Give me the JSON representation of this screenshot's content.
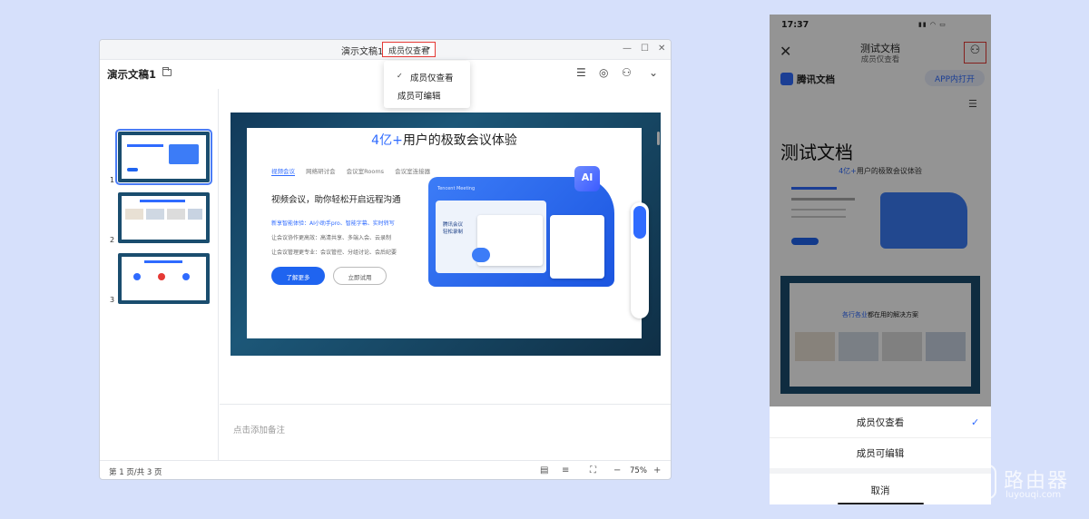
{
  "desktop": {
    "window_title": "演示文稿1",
    "permission_button": "成员仅查看",
    "doc_name": "演示文稿1",
    "dropdown": {
      "items": [
        "成员仅查看",
        "成员可编辑"
      ],
      "checked_index": 0
    },
    "thumbnails": [
      "1",
      "2",
      "3"
    ],
    "slide": {
      "title_highlight": "4亿+",
      "title_rest": "用户的极致会议体验",
      "tabs": [
        "视频会议",
        "网络研讨会",
        "会议室Rooms",
        "会议室连接器"
      ],
      "heading": "视频会议，助你轻松开启远程沟通",
      "para_blue": "新享智能体验：AI小助手pro、智能字幕、实时转写",
      "para2": "让会议协作更高效：高清共享、多端入会、云录制",
      "para3": "让会议管理更专业：会议管控、分组讨论、会后纪要",
      "btn_primary": "了解更多",
      "btn_secondary": "立即试用",
      "card_brand": "Tencent Meeting",
      "card_text": "腾讯会议\n轻松录制",
      "ai_badge": "AI"
    },
    "notes_placeholder": "点击添加备注",
    "status": {
      "pages": "第 1 页/共 3 页",
      "zoom": "75%"
    }
  },
  "phone": {
    "time": "17:37",
    "doc_title": "测试文档",
    "doc_sub": "成员仅查看",
    "brand": "腾讯文档",
    "open_in_app": "APP内打开",
    "page_heading": "测试文档",
    "page_line_highlight": "4亿+",
    "page_line_rest": "用户的极致会议体验",
    "slide2_title_highlight": "各行各业",
    "slide2_title_rest": "都在用的解决方案",
    "sheet": {
      "option_view": "成员仅查看",
      "option_edit": "成员可编辑",
      "cancel": "取消"
    }
  },
  "watermark": {
    "text": "路由器",
    "url": "luyouqi.com"
  },
  "colors": {
    "accent": "#2f6bff",
    "highlight_border": "#e53935",
    "backdrop": "#d6e0fb"
  }
}
